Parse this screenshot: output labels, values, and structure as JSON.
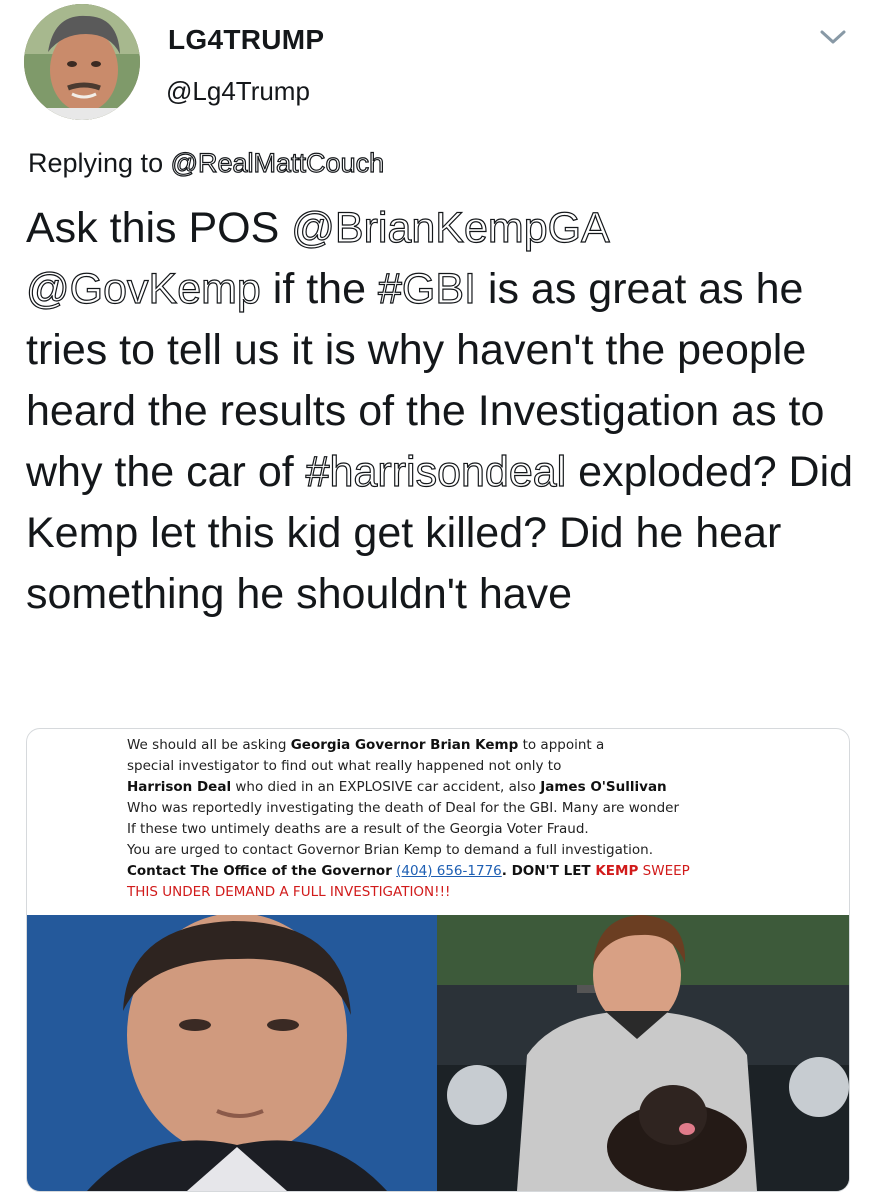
{
  "user": {
    "display_name": "LG4TRUMP",
    "handle": "@Lg4Trump"
  },
  "reply": {
    "prefix": "Replying to",
    "target": "@RealMattCouch"
  },
  "tweet": {
    "t1": "Ask this POS ",
    "m1": "@BrianKempGA",
    "m2": "@GovKemp",
    "t2": " if the ",
    "h1": "#GBI",
    "t3": " is as great as he tries to tell us it is why haven't the people heard the results of the Investigation as to why the car of ",
    "h2": "#harrisondeal",
    "t4": " exploded? Did Kemp let this kid get killed? Did he hear something he shouldn't have"
  },
  "notice": {
    "l1a": "We should all be asking ",
    "l1b": "Georgia Governor Brian Kemp",
    "l1c": " to appoint a",
    "l2": "special investigator to find out what really happened not only to",
    "l3a": "Harrison Deal",
    "l3b": " who died in an EXPLOSIVE car accident, also ",
    "l3c": "James O'Sullivan",
    "l4": "Who was reportedly investigating the death of Deal for the GBI. Many are wonder",
    "l5": "If these two untimely deaths are a result of the Georgia Voter Fraud.",
    "l6": "You are urged to contact Governor Brian Kemp to demand a full investigation.",
    "l7a": "Contact The Office of the Governor",
    "l7b": "(404) 656-1776",
    "l7c": ". DON'T LET ",
    "l7d": "KEMP",
    "l7e": " SWEEP",
    "l8": "THIS UNDER DEMAND A FULL INVESTIGATION!!!"
  },
  "icons": {
    "menu": "chevron-down-icon"
  },
  "colors": {
    "notice_red": "#d11b1b",
    "link_blue": "#1e5fb3"
  }
}
